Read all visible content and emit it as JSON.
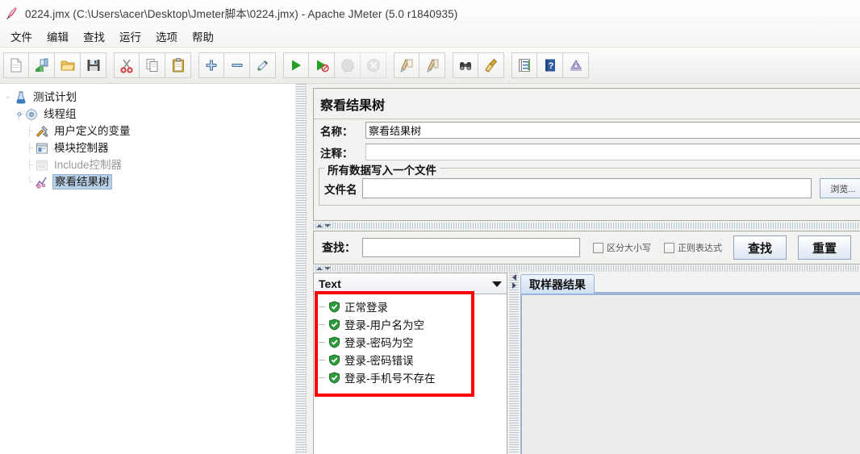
{
  "window": {
    "title": "0224.jmx (C:\\Users\\acer\\Desktop\\Jmeter脚本\\0224.jmx) - Apache JMeter (5.0 r1840935)",
    "app_icon": "jmeter-feather-icon"
  },
  "menu": {
    "items": [
      {
        "label": "文件",
        "name": "menu-file"
      },
      {
        "label": "编辑",
        "name": "menu-edit"
      },
      {
        "label": "查找",
        "name": "menu-search"
      },
      {
        "label": "运行",
        "name": "menu-run"
      },
      {
        "label": "选项",
        "name": "menu-options"
      },
      {
        "label": "帮助",
        "name": "menu-help"
      }
    ]
  },
  "toolbar": {
    "buttons": [
      {
        "icon": "new-file-icon",
        "enabled": true
      },
      {
        "icon": "templates-icon",
        "enabled": true
      },
      {
        "icon": "open-folder-icon",
        "enabled": true
      },
      {
        "icon": "save-icon",
        "enabled": true
      },
      {
        "icon": "cut-scissors-icon",
        "enabled": true
      },
      {
        "icon": "copy-icon",
        "enabled": true
      },
      {
        "icon": "paste-icon",
        "enabled": true
      },
      {
        "icon": "expand-plus-icon",
        "enabled": true
      },
      {
        "icon": "collapse-minus-icon",
        "enabled": true
      },
      {
        "icon": "toggle-icon",
        "enabled": true
      },
      {
        "icon": "start-play-icon",
        "enabled": true
      },
      {
        "icon": "start-no-pauses-icon",
        "enabled": true
      },
      {
        "icon": "stop-icon",
        "enabled": false
      },
      {
        "icon": "shutdown-icon",
        "enabled": false
      },
      {
        "icon": "clear-icon",
        "enabled": true
      },
      {
        "icon": "clear-all-icon",
        "enabled": true
      },
      {
        "icon": "search-binoculars-icon",
        "enabled": true
      },
      {
        "icon": "search-reset-broom-icon",
        "enabled": true
      },
      {
        "icon": "function-helper-icon",
        "enabled": true
      },
      {
        "icon": "help-book-icon",
        "enabled": true
      },
      {
        "icon": "undo-redo-icon",
        "enabled": true
      }
    ]
  },
  "tree": {
    "nodes": [
      {
        "label": "测试计划",
        "icon": "test-plan-icon",
        "depth": 0,
        "state": "normal",
        "name": "tree-node-test-plan"
      },
      {
        "label": "线程组",
        "icon": "thread-group-gear-icon",
        "depth": 1,
        "state": "normal",
        "name": "tree-node-thread-group"
      },
      {
        "label": "用户定义的变量",
        "icon": "user-defined-variables-icon",
        "depth": 2,
        "state": "normal",
        "name": "tree-node-user-defined-variables"
      },
      {
        "label": "模块控制器",
        "icon": "module-controller-icon",
        "depth": 2,
        "state": "normal",
        "name": "tree-node-module-controller"
      },
      {
        "label": "Include控制器",
        "icon": "include-controller-icon",
        "depth": 2,
        "state": "disabled",
        "name": "tree-node-include-controller"
      },
      {
        "label": "察看结果树",
        "icon": "view-results-tree-icon",
        "depth": 2,
        "state": "selected",
        "name": "tree-node-view-results-tree"
      }
    ]
  },
  "config": {
    "panel_title": "察看结果树",
    "name_label": "名称：",
    "name_value": "察看结果树",
    "comment_label": "注释：",
    "comment_value": "",
    "group_title": "所有数据写入一个文件",
    "filename_label": "文件名",
    "filename_value": "",
    "browse_label": "浏览..."
  },
  "search": {
    "label": "查找：",
    "value": "",
    "case_sensitive_label": "区分大小写",
    "case_sensitive_checked": false,
    "regex_label": "正则表达式",
    "regex_checked": false,
    "search_button": "查找",
    "reset_button": "重置"
  },
  "results": {
    "render_selector": "Text",
    "items": [
      {
        "label": "正常登录",
        "status": "success",
        "icon": "green-shield-check-icon"
      },
      {
        "label": "登录-用户名为空",
        "status": "success",
        "icon": "green-shield-check-icon"
      },
      {
        "label": "登录-密码为空",
        "status": "success",
        "icon": "green-shield-check-icon"
      },
      {
        "label": "登录-密码错误",
        "status": "success",
        "icon": "green-shield-check-icon"
      },
      {
        "label": "登录-手机号不存在",
        "status": "success",
        "icon": "green-shield-check-icon"
      }
    ],
    "tabs": [
      {
        "label": "取样器结果",
        "active": true,
        "name": "tab-sampler-result"
      }
    ],
    "detail_content": ""
  },
  "annotation": {
    "color": "#ff0000",
    "shape": "rectangle",
    "target": "results-list"
  },
  "colors": {
    "title_text": "#3a3a3a",
    "selection": "#b8cfe5",
    "success_green": "#2e9b3d",
    "tab_blue": "#cfe0f3",
    "annotation_red": "#ff0000",
    "panel_bg": "#f2f2f0"
  }
}
